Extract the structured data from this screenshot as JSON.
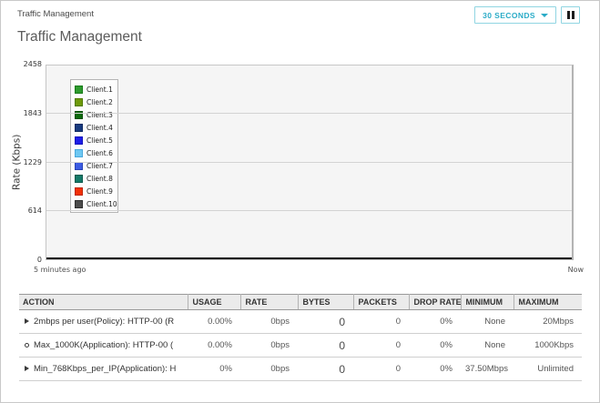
{
  "header": {
    "breadcrumb": "Traffic Management",
    "refresh_interval_label": "30 SECONDS",
    "pause_icon": "pause"
  },
  "title": "Traffic Management",
  "colors": {
    "accent_cyan": "#29abc7",
    "accent_cyan_border": "#90d5e2",
    "plot_background": "#f5f5f5",
    "gridline": "#d3d3d3",
    "table_header_bg": "#ebebeb"
  },
  "chart_data": {
    "type": "line",
    "title": "",
    "ylabel": "Rate (Kbps)",
    "ylim": [
      0,
      2458
    ],
    "yticks": [
      "0",
      "614",
      "1229",
      "1843",
      "2458"
    ],
    "x_left_label": "5 minutes ago",
    "x_right_label": "Now",
    "grid": "horizontal",
    "legend_position": "inside-top-left",
    "series": [
      {
        "name": "Client.1",
        "color": "#2e9b2e",
        "border": "#157a17",
        "values": [
          0,
          0
        ]
      },
      {
        "name": "Client.2",
        "color": "#6f9a0b",
        "border": "#4f7a00",
        "values": [
          0,
          0
        ]
      },
      {
        "name": "Client.3",
        "color": "#0d6b0d",
        "border": "#074f07",
        "values": [
          0,
          0
        ]
      },
      {
        "name": "Client.4",
        "color": "#173a7e",
        "border": "#0e2a62",
        "values": [
          0,
          0
        ]
      },
      {
        "name": "Client.5",
        "color": "#1e1ee8",
        "border": "#1111bb",
        "values": [
          0,
          0
        ]
      },
      {
        "name": "Client.6",
        "color": "#6fc8f2",
        "border": "#49a8dc",
        "values": [
          0,
          0
        ]
      },
      {
        "name": "Client.7",
        "color": "#3c5ce2",
        "border": "#2742b6",
        "values": [
          0,
          0
        ]
      },
      {
        "name": "Client.8",
        "color": "#137968",
        "border": "#0b594c",
        "values": [
          0,
          0
        ]
      },
      {
        "name": "Client.9",
        "color": "#f23007",
        "border": "#bd2503",
        "values": [
          0,
          0
        ]
      },
      {
        "name": "Client.10",
        "color": "#4c4c4c",
        "border": "#2e2e2e",
        "values": [
          0,
          0
        ]
      }
    ]
  },
  "table": {
    "columns": [
      "ACTION",
      "USAGE",
      "RATE",
      "BYTES",
      "PACKETS",
      "DROP RATE",
      "MINIMUM",
      "MAXIMUM"
    ],
    "rows": [
      {
        "bullet": "triangle",
        "action": "2mbps per user(Policy): HTTP-00 (R",
        "usage": "0.00%",
        "rate": "0bps",
        "bytes": "0",
        "packets": "0",
        "drop_rate": "0%",
        "minimum": "None",
        "maximum": "20Mbps"
      },
      {
        "bullet": "circle",
        "action": "Max_1000K(Application): HTTP-00 (",
        "usage": "0.00%",
        "rate": "0bps",
        "bytes": "0",
        "packets": "0",
        "drop_rate": "0%",
        "minimum": "None",
        "maximum": "1000Kbps"
      },
      {
        "bullet": "triangle",
        "action": "Min_768Kbps_per_IP(Application): H",
        "usage": "0%",
        "rate": "0bps",
        "bytes": "0",
        "packets": "0",
        "drop_rate": "0%",
        "minimum": "37.50Mbps",
        "maximum": "Unlimited"
      }
    ]
  }
}
